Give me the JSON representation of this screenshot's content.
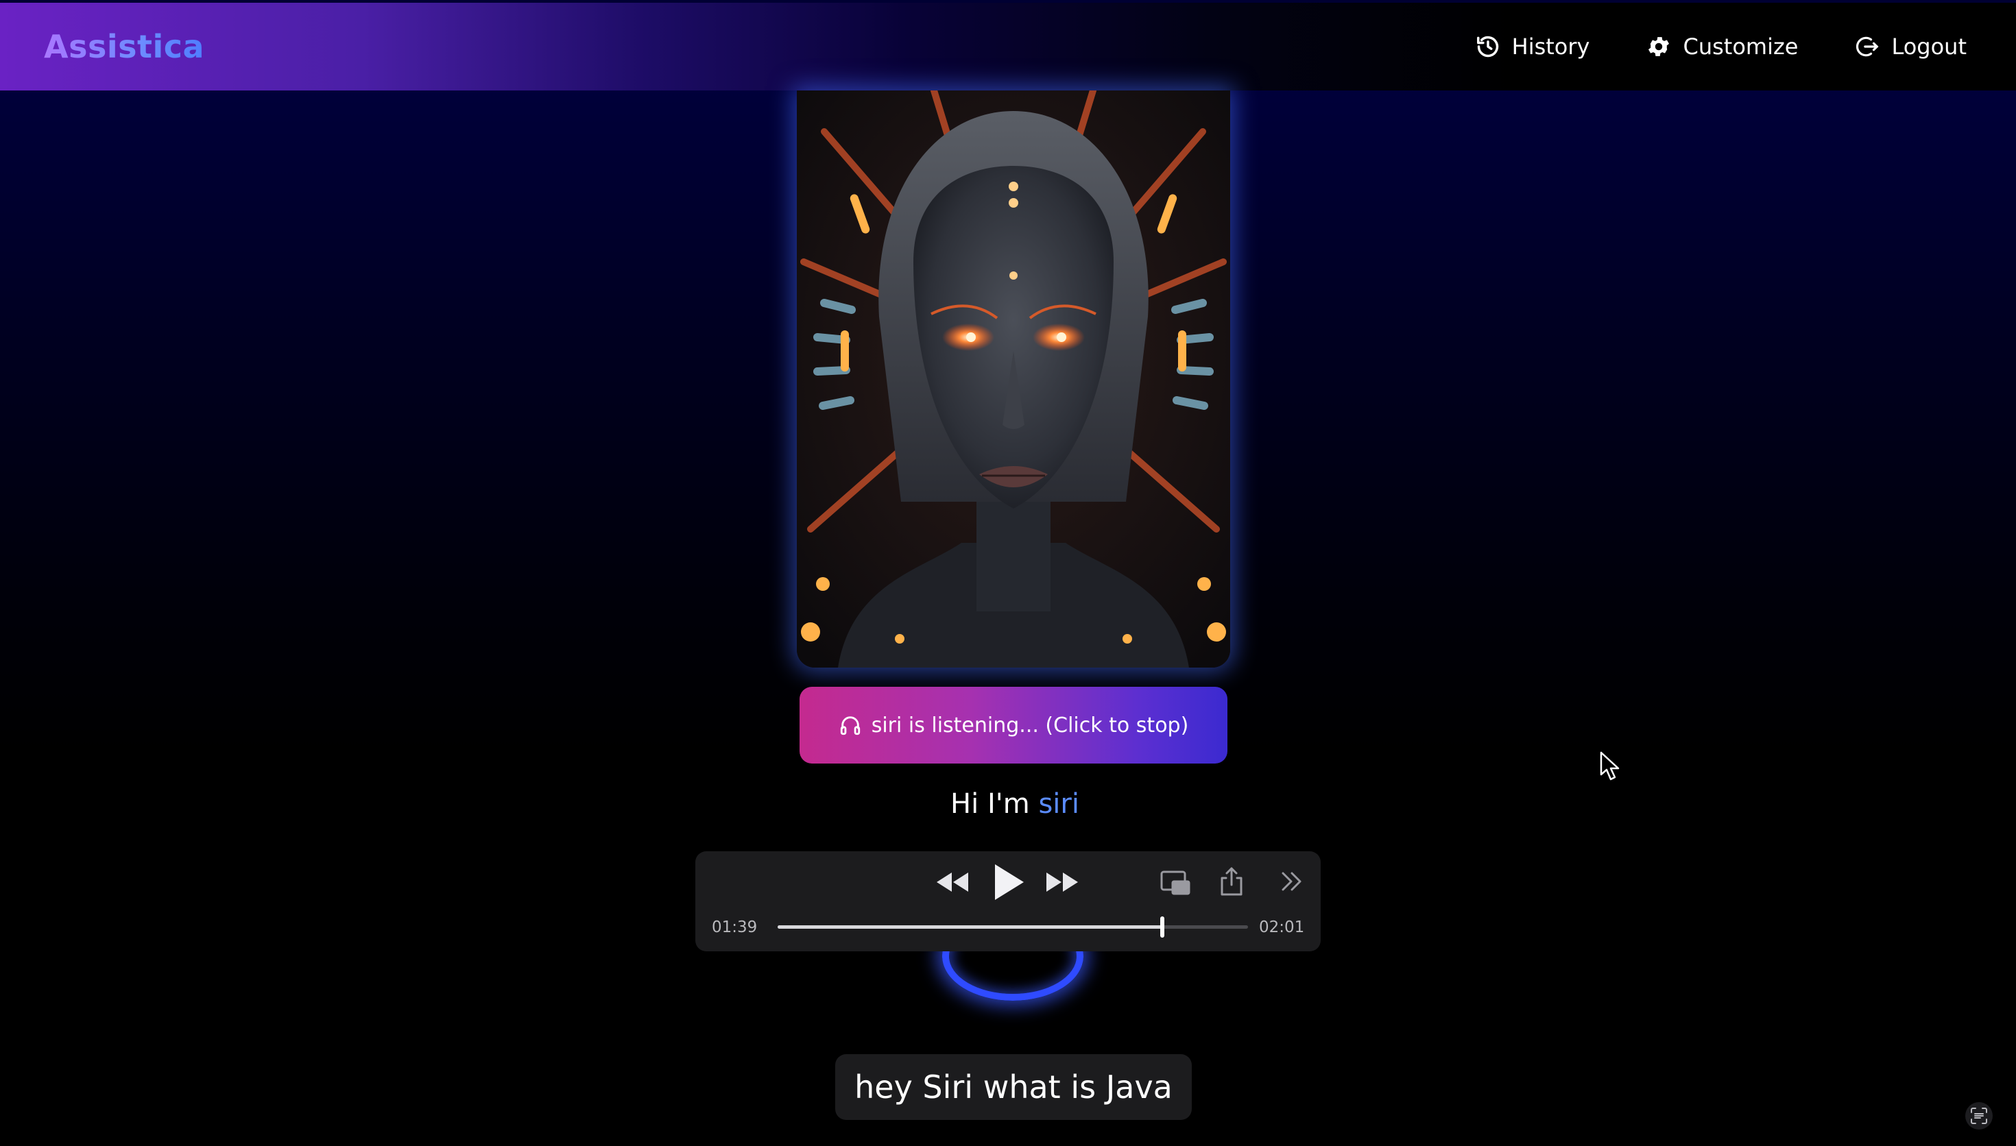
{
  "app": {
    "brand": "Assistica"
  },
  "nav": {
    "items": [
      {
        "label": "History",
        "icon": "history-icon"
      },
      {
        "label": "Customize",
        "icon": "gear-icon"
      },
      {
        "label": "Logout",
        "icon": "logout-icon"
      }
    ]
  },
  "assistant": {
    "portrait_icon": "robot-face-portrait",
    "listen_label": "siri is listening... (Click to stop)",
    "listen_icon": "headphones-icon",
    "greeting_prefix": "Hi I'm",
    "name": "siri"
  },
  "player": {
    "elapsed": "01:39",
    "duration": "02:01",
    "progress": 0.818,
    "controls": [
      "rewind-icon",
      "play-icon",
      "fast-forward-icon",
      "picture-in-picture-icon",
      "share-icon",
      "more-chevron-icon"
    ]
  },
  "transcript": {
    "text": "hey Siri what is Java"
  },
  "colors": {
    "accent_blue": "#5b8cff",
    "button_gradient_start": "#c42a8f",
    "button_gradient_end": "#3b2ad0",
    "player_bg": "#1c1c1e"
  }
}
